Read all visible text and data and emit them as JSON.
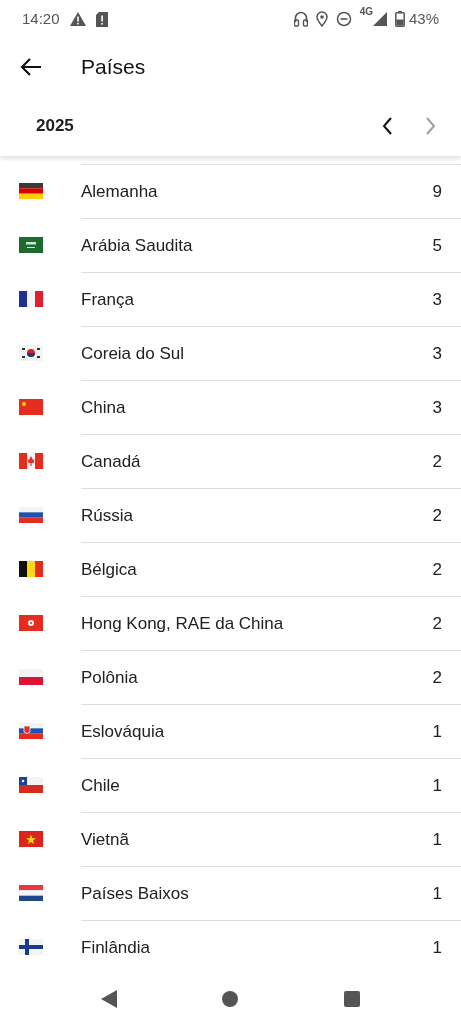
{
  "status_bar": {
    "time": "14:20",
    "network": "4G",
    "battery": "43%"
  },
  "toolbar": {
    "title": "Países"
  },
  "year_bar": {
    "year": "2025",
    "prev_disabled": false,
    "next_disabled": true
  },
  "countries": [
    {
      "name": "Alemanha",
      "count": "9",
      "kind": "germany"
    },
    {
      "name": "Arábia Saudita",
      "count": "5",
      "kind": "saudi"
    },
    {
      "name": "França",
      "count": "3",
      "kind": "france"
    },
    {
      "name": "Coreia do Sul",
      "count": "3",
      "kind": "korea"
    },
    {
      "name": "China",
      "count": "3",
      "kind": "china"
    },
    {
      "name": "Canadá",
      "count": "2",
      "kind": "canada"
    },
    {
      "name": "Rússia",
      "count": "2",
      "kind": "russia"
    },
    {
      "name": "Bélgica",
      "count": "2",
      "kind": "belgium"
    },
    {
      "name": "Hong Kong, RAE da China",
      "count": "2",
      "kind": "hongkong"
    },
    {
      "name": "Polônia",
      "count": "2",
      "kind": "poland"
    },
    {
      "name": "Eslováquia",
      "count": "1",
      "kind": "slovakia"
    },
    {
      "name": "Chile",
      "count": "1",
      "kind": "chile"
    },
    {
      "name": "Vietnã",
      "count": "1",
      "kind": "vietnam"
    },
    {
      "name": "Países Baixos",
      "count": "1",
      "kind": "netherlands"
    },
    {
      "name": "Finlândia",
      "count": "1",
      "kind": "finland"
    }
  ]
}
